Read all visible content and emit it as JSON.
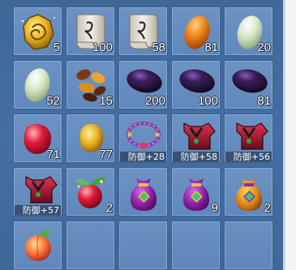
{
  "inventory": {
    "slots": [
      {
        "icon": "golden-ring-crystal-icon",
        "quantity": "5"
      },
      {
        "icon": "rune-scroll-icon",
        "quantity": "100"
      },
      {
        "icon": "rune-scroll-icon",
        "quantity": "58"
      },
      {
        "icon": "orange-egg-icon",
        "quantity": "81"
      },
      {
        "icon": "pale-green-egg-icon",
        "quantity": "20"
      },
      {
        "icon": "pale-green-egg-icon",
        "quantity": "52"
      },
      {
        "icon": "mixed-seeds-icon",
        "quantity": "15"
      },
      {
        "icon": "dark-purple-bean-icon",
        "quantity": "200"
      },
      {
        "icon": "dark-purple-bean-icon",
        "quantity": "100"
      },
      {
        "icon": "dark-purple-bean-icon",
        "quantity": "81"
      },
      {
        "icon": "red-gem-icon",
        "quantity": "71"
      },
      {
        "icon": "golden-gem-icon",
        "quantity": "77"
      },
      {
        "icon": "purple-necklace-icon",
        "defense": "防御+28"
      },
      {
        "icon": "red-armor-icon",
        "defense": "防御+58"
      },
      {
        "icon": "red-armor-icon",
        "defense": "防御+56"
      },
      {
        "icon": "red-armor-icon",
        "defense": "防御+57"
      },
      {
        "icon": "spirit-fruit-icon",
        "quantity": "2"
      },
      {
        "icon": "purple-pouch-icon",
        "quantity": ""
      },
      {
        "icon": "purple-pouch-icon",
        "quantity": "9"
      },
      {
        "icon": "orange-pouch-icon",
        "quantity": "2"
      },
      {
        "icon": "peach-icon",
        "quantity": ""
      }
    ]
  }
}
